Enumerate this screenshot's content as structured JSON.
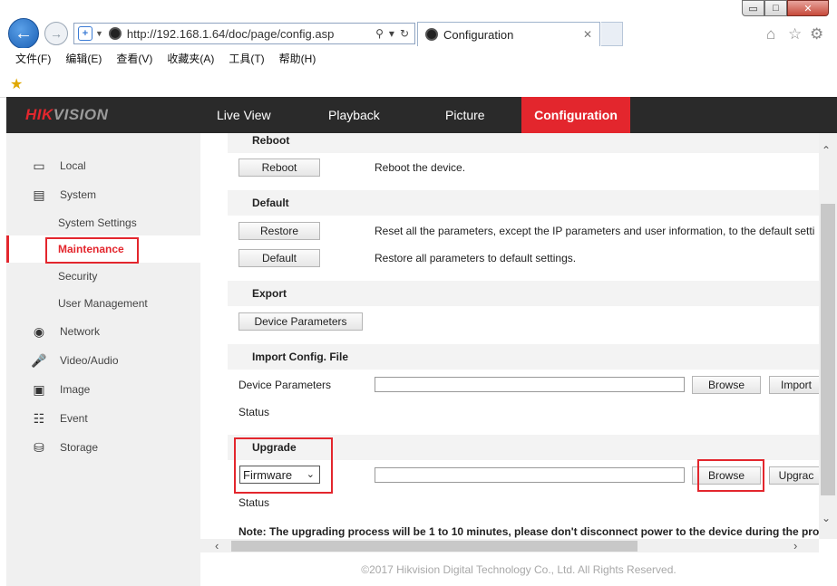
{
  "browser": {
    "window_controls": {
      "minimize": "▭",
      "maximize": "□",
      "close": "✕"
    },
    "url": "http://192.168.1.64/doc/page/config.asp",
    "tab_title": "Configuration",
    "menu": [
      "文件(F)",
      "编辑(E)",
      "查看(V)",
      "收藏夹(A)",
      "工具(T)",
      "帮助(H)"
    ],
    "icons": {
      "back": "back-arrow-icon",
      "forward": "forward-arrow-icon",
      "home": "home-icon",
      "favorites": "star-icon",
      "tools": "gear-icon"
    }
  },
  "header": {
    "logo_red": "HIK",
    "logo_gray": "VISION",
    "nav": [
      "Live View",
      "Playback",
      "Picture",
      "Configuration"
    ],
    "active_nav": "Configuration",
    "accent_color": "#e3262d"
  },
  "sidebar": {
    "items": [
      {
        "label": "Local",
        "icon": "monitor-icon"
      },
      {
        "label": "System",
        "icon": "system-window-icon"
      },
      {
        "label": "System Settings"
      },
      {
        "label": "Maintenance"
      },
      {
        "label": "Security"
      },
      {
        "label": "User Management"
      },
      {
        "label": "Network",
        "icon": "globe-icon"
      },
      {
        "label": "Video/Audio",
        "icon": "microphone-icon"
      },
      {
        "label": "Image",
        "icon": "image-icon"
      },
      {
        "label": "Event",
        "icon": "calendar-icon"
      },
      {
        "label": "Storage",
        "icon": "storage-icon"
      }
    ],
    "active": "Maintenance"
  },
  "content": {
    "reboot": {
      "title": "Reboot",
      "button": "Reboot",
      "desc": "Reboot the device."
    },
    "default": {
      "title": "Default",
      "restore_button": "Restore",
      "restore_desc": "Reset all the parameters, except the IP parameters and user information, to the default setti",
      "default_button": "Default",
      "default_desc": "Restore all parameters to default settings."
    },
    "export": {
      "title": "Export",
      "button": "Device Parameters"
    },
    "import": {
      "title": "Import Config. File",
      "label": "Device Parameters",
      "file_value": "",
      "browse": "Browse",
      "import": "Import",
      "status_label": "Status"
    },
    "upgrade": {
      "title": "Upgrade",
      "select_value": "Firmware",
      "file_value": "",
      "browse": "Browse",
      "upgrade": "Upgrac",
      "status_label": "Status",
      "note": "Note: The upgrading process will be 1 to 10 minutes, please don't disconnect power to the device during the pro"
    }
  },
  "footer": "©2017 Hikvision Digital Technology Co., Ltd. All Rights Reserved."
}
